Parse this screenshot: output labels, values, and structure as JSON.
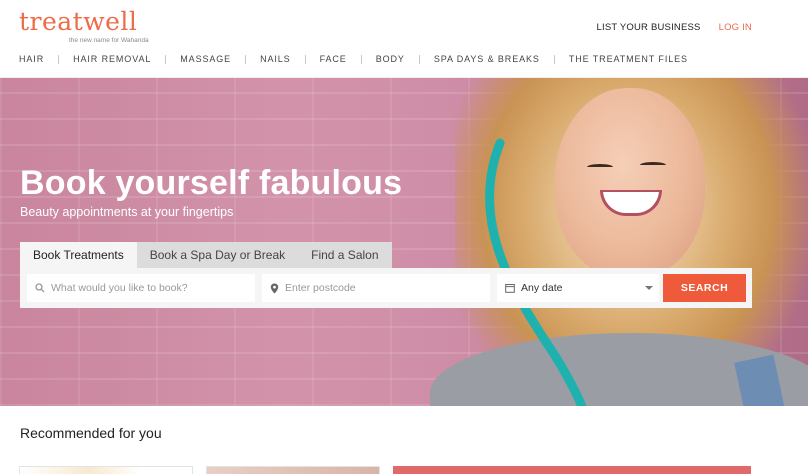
{
  "brand": {
    "logo_text": "treatwell",
    "tagline": "the new name for Wahanda",
    "accent_color": "#ee6a48"
  },
  "top_links": {
    "list_business": "LIST YOUR BUSINESS",
    "login": "LOG IN"
  },
  "nav": {
    "items": [
      "HAIR",
      "HAIR REMOVAL",
      "MASSAGE",
      "NAILS",
      "FACE",
      "BODY",
      "SPA DAYS & BREAKS",
      "THE TREATMENT FILES"
    ]
  },
  "hero": {
    "title": "Book yourself fabulous",
    "subtitle": "Beauty appointments at your fingertips"
  },
  "search": {
    "tabs": [
      "Book Treatments",
      "Book a Spa Day or Break",
      "Find a Salon"
    ],
    "active_tab": "Book Treatments",
    "treatment_placeholder": "What would you like to book?",
    "postcode_placeholder": "Enter postcode",
    "date_value": "Any date",
    "search_button": "SEARCH",
    "button_color": "#ee5a3a",
    "icons": {
      "treatment": "search-icon",
      "postcode": "location-pin-icon",
      "date": "calendar-icon"
    }
  },
  "recommended": {
    "title": "Recommended for you"
  }
}
